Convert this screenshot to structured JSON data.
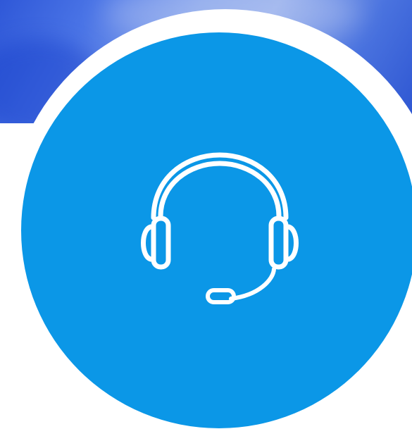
{
  "graphic": {
    "icon": "headset-icon",
    "colors": {
      "disc": "#0b97e7",
      "ring": "#ffffff",
      "backdrop": "#4a74e6"
    }
  }
}
